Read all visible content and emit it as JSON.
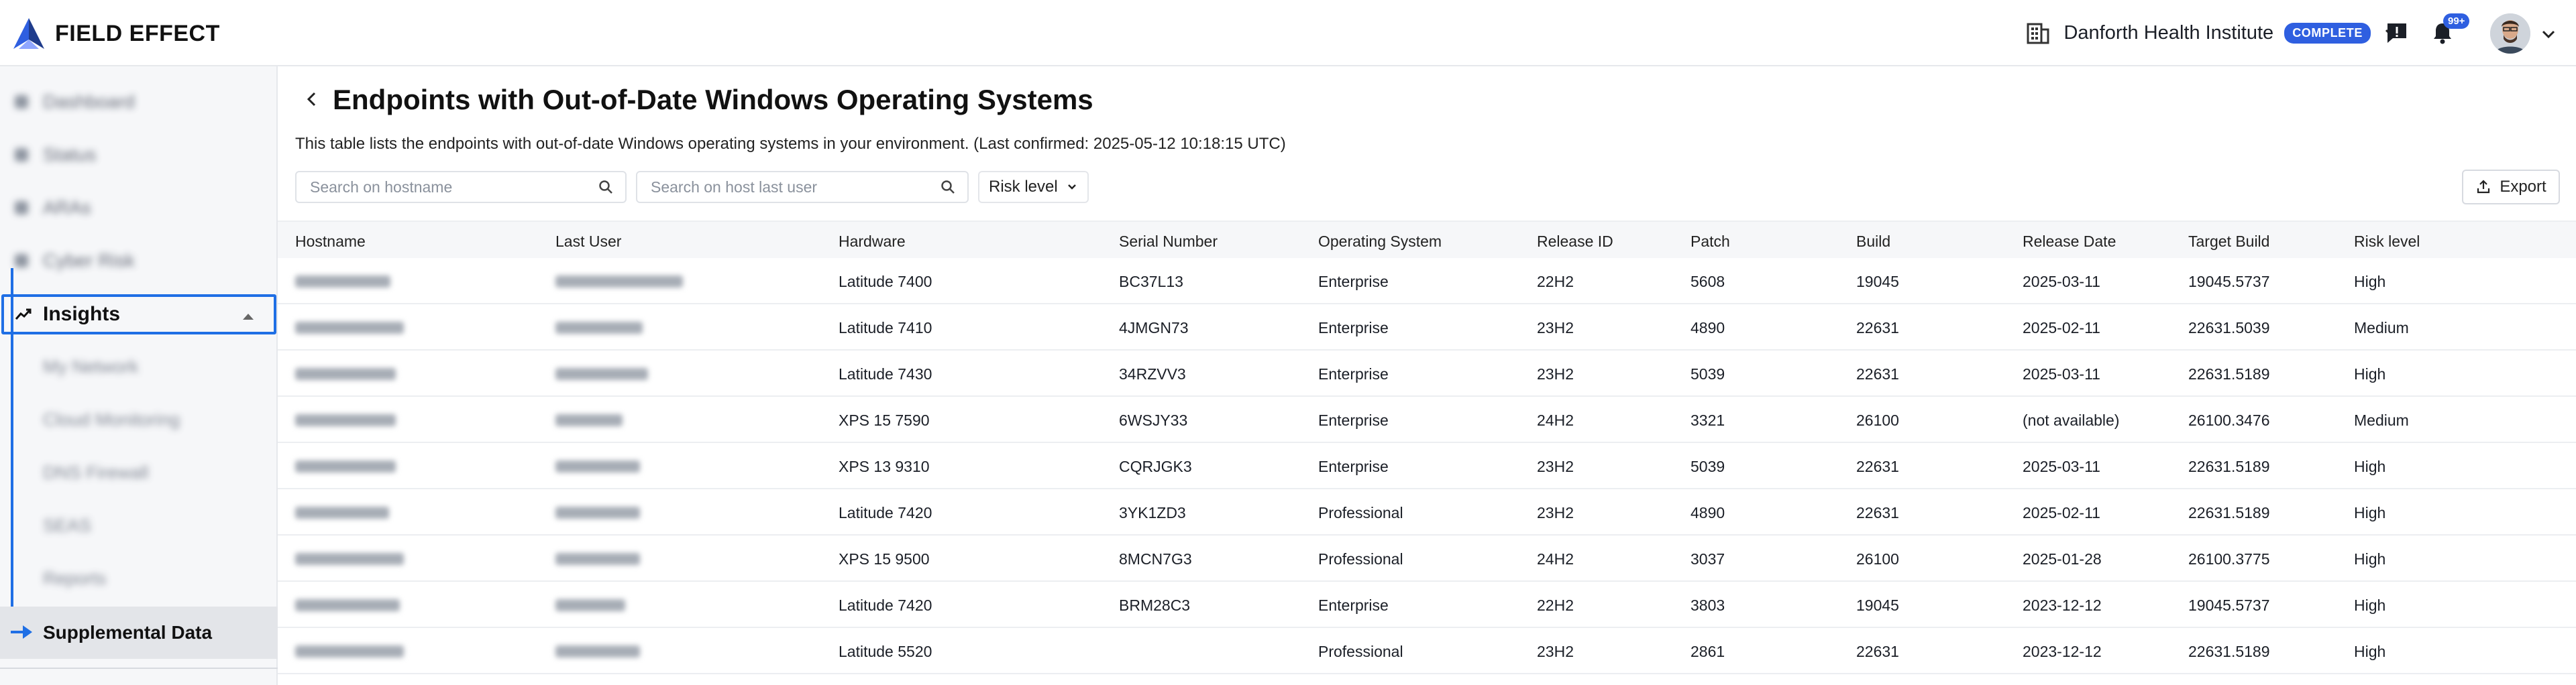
{
  "header": {
    "brand": "FIELD EFFECT",
    "org_name": "Danforth Health Institute",
    "org_badge": "COMPLETE",
    "notifications_count": "99+",
    "accent": "#2f5fe0"
  },
  "sidebar": {
    "active_section": "Insights",
    "active_item": "Supplemental Data"
  },
  "page": {
    "title": "Endpoints with Out-of-Date Windows Operating Systems",
    "description": "This table lists the endpoints with out-of-date Windows operating systems in your environment. (Last confirmed: 2025-05-12 10:18:15 UTC)",
    "search_hostname_placeholder": "Search on hostname",
    "search_user_placeholder": "Search on host last user",
    "risk_filter_label": "Risk level",
    "export_label": "Export"
  },
  "table": {
    "columns": [
      "Hostname",
      "Last User",
      "Hardware",
      "Serial Number",
      "Operating System",
      "Release ID",
      "Patch",
      "Build",
      "Release Date",
      "Target Build",
      "Risk level"
    ],
    "rows": [
      {
        "hardware": "Latitude 7400",
        "serial": "BC37L13",
        "os": "Enterprise",
        "release_id": "22H2",
        "patch": "5608",
        "build": "19045",
        "release_date": "2025-03-11",
        "target_build": "19045.5737",
        "risk": "High"
      },
      {
        "hardware": "Latitude 7410",
        "serial": "4JMGN73",
        "os": "Enterprise",
        "release_id": "23H2",
        "patch": "4890",
        "build": "22631",
        "release_date": "2025-02-11",
        "target_build": "22631.5039",
        "risk": "Medium"
      },
      {
        "hardware": "Latitude 7430",
        "serial": "34RZVV3",
        "os": "Enterprise",
        "release_id": "23H2",
        "patch": "5039",
        "build": "22631",
        "release_date": "2025-03-11",
        "target_build": "22631.5189",
        "risk": "High"
      },
      {
        "hardware": "XPS 15 7590",
        "serial": "6WSJY33",
        "os": "Enterprise",
        "release_id": "24H2",
        "patch": "3321",
        "build": "26100",
        "release_date": "(not available)",
        "target_build": "26100.3476",
        "risk": "Medium"
      },
      {
        "hardware": "XPS 13 9310",
        "serial": "CQRJGK3",
        "os": "Enterprise",
        "release_id": "23H2",
        "patch": "5039",
        "build": "22631",
        "release_date": "2025-03-11",
        "target_build": "22631.5189",
        "risk": "High"
      },
      {
        "hardware": "Latitude 7420",
        "serial": "3YK1ZD3",
        "os": "Professional",
        "release_id": "23H2",
        "patch": "4890",
        "build": "22631",
        "release_date": "2025-02-11",
        "target_build": "22631.5189",
        "risk": "High"
      },
      {
        "hardware": "XPS 15 9500",
        "serial": "8MCN7G3",
        "os": "Professional",
        "release_id": "24H2",
        "patch": "3037",
        "build": "26100",
        "release_date": "2025-01-28",
        "target_build": "26100.3775",
        "risk": "High"
      },
      {
        "hardware": "Latitude 7420",
        "serial": "BRM28C3",
        "os": "Enterprise",
        "release_id": "22H2",
        "patch": "3803",
        "build": "19045",
        "release_date": "2023-12-12",
        "target_build": "19045.5737",
        "risk": "High"
      },
      {
        "hardware": "Latitude 5520",
        "serial": "",
        "os": "Professional",
        "release_id": "23H2",
        "patch": "2861",
        "build": "22631",
        "release_date": "2023-12-12",
        "target_build": "22631.5189",
        "risk": "High"
      }
    ]
  }
}
